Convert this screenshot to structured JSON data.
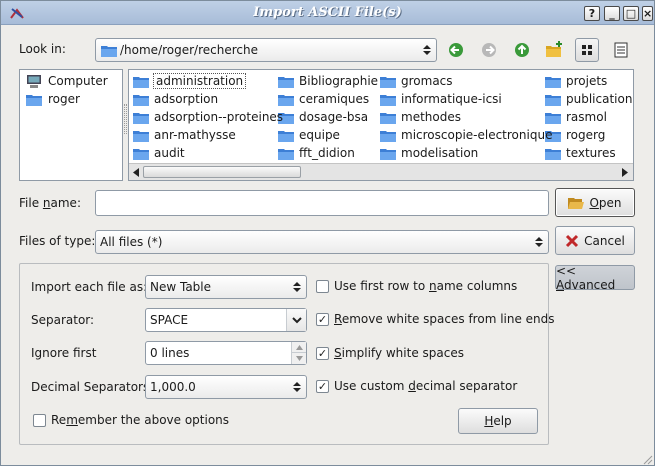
{
  "window": {
    "title": "Import ASCII File(s)",
    "buttons": {
      "help": "?",
      "minimize": "_",
      "maximize": "□",
      "close": "×"
    }
  },
  "look_in": {
    "label": "Look in:",
    "path": "/home/roger/recherche",
    "tools": [
      "back-arrow-icon",
      "forward-arrow-icon",
      "up-arrow-icon",
      "new-folder-icon",
      "icon-view-icon",
      "detail-view-icon"
    ]
  },
  "sidebar": {
    "items": [
      {
        "label": "Computer",
        "icon": "computer-icon"
      },
      {
        "label": "roger",
        "icon": "folder-icon"
      }
    ]
  },
  "files": {
    "col1": [
      "administration",
      "adsorption",
      "adsorption--proteines",
      "anr-mathysse",
      "audit"
    ],
    "col2": [
      "Bibliographie",
      "ceramiques",
      "dosage-bsa",
      "equipe",
      "fft_didion"
    ],
    "col3": [
      "gromacs",
      "informatique-icsi",
      "methodes",
      "microscopie-electronique",
      "modelisation"
    ],
    "col4": [
      "projets",
      "publications",
      "rasmol",
      "rogerg",
      "textures"
    ],
    "selected": "administration"
  },
  "file_name": {
    "label_pre": "File ",
    "label_u": "n",
    "label_post": "ame:",
    "value": ""
  },
  "file_type": {
    "label": "Files of type:",
    "value": "All files (*)"
  },
  "buttons": {
    "open_u": "O",
    "open_rest": "pen",
    "cancel": "Cancel",
    "advanced_pre": "<< ",
    "advanced_u": "A",
    "advanced_rest": "dvanced",
    "help_u": "H",
    "help_rest": "elp"
  },
  "options": {
    "import_each_label": "Import each file as:",
    "import_each_value": "New Table",
    "separator_label": "Separator:",
    "separator_value": "SPACE",
    "ignore_first_label": "Ignore first",
    "ignore_first_value": "0 lines",
    "decimal_label": "Decimal Separators",
    "decimal_value": "1,000.0",
    "remember_pre": "Re",
    "remember_u": "m",
    "remember_post": "ember the above options",
    "first_row_pre": "Use first row to ",
    "first_row_u": "n",
    "first_row_post": "ame columns",
    "remove_ws_u": "R",
    "remove_ws_post": "emove white spaces from line ends",
    "simplify_u": "S",
    "simplify_post": "implify white spaces",
    "custom_dec_pre": "Use custom ",
    "custom_dec_u": "d",
    "custom_dec_post": "ecimal separator",
    "checked": {
      "first_row": false,
      "remove_ws": true,
      "simplify": true,
      "custom_dec": true,
      "remember": false
    }
  }
}
